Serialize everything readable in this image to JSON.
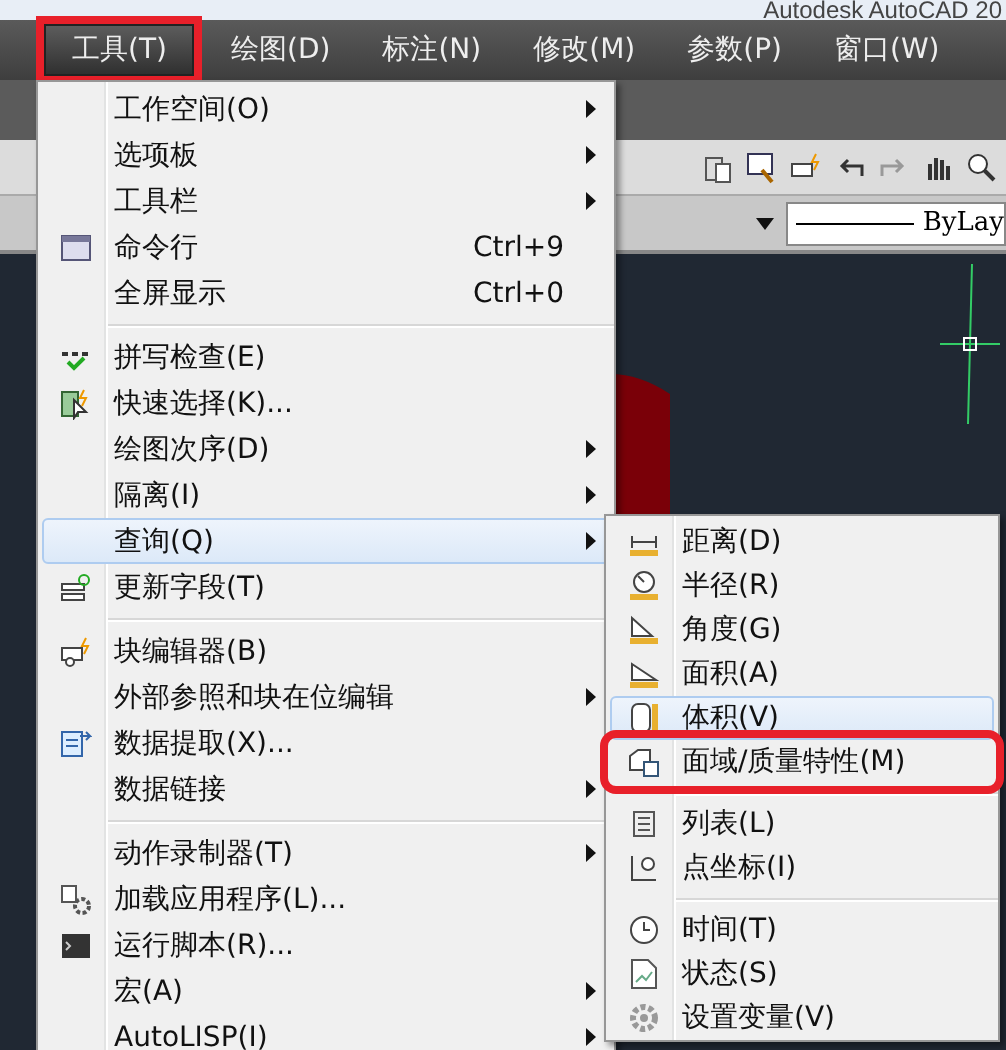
{
  "window": {
    "title": "Autodesk AutoCAD 20"
  },
  "menubar": [
    {
      "label": "工具(T)",
      "selected": true,
      "highlighted": true
    },
    {
      "label": "绘图(D)",
      "selected": false
    },
    {
      "label": "标注(N)",
      "selected": false
    },
    {
      "label": "修改(M)",
      "selected": false
    },
    {
      "label": "参数(P)",
      "selected": false
    },
    {
      "label": "窗口(W)",
      "selected": false
    }
  ],
  "properties": {
    "linetype": "ByLay"
  },
  "menu": [
    {
      "kind": "item",
      "label": "工作空间(O)",
      "submenu": true,
      "selected": false
    },
    {
      "kind": "item",
      "label": "选项板",
      "submenu": true,
      "selected": false
    },
    {
      "kind": "item",
      "label": "工具栏",
      "submenu": true,
      "selected": false
    },
    {
      "kind": "item",
      "label": "命令行",
      "shortcut": "Ctrl+9",
      "submenu": false,
      "selected": false
    },
    {
      "kind": "item",
      "label": "全屏显示",
      "shortcut": "Ctrl+0",
      "submenu": false,
      "selected": false
    },
    {
      "kind": "separator"
    },
    {
      "kind": "item",
      "label": "拼写检查(E)",
      "submenu": false,
      "selected": false
    },
    {
      "kind": "item",
      "label": "快速选择(K)...",
      "submenu": false,
      "selected": false
    },
    {
      "kind": "item",
      "label": "绘图次序(D)",
      "submenu": true,
      "selected": false
    },
    {
      "kind": "item",
      "label": "隔离(I)",
      "submenu": true,
      "selected": false
    },
    {
      "kind": "item",
      "label": "查询(Q)",
      "submenu": true,
      "selected": true
    },
    {
      "kind": "item",
      "label": "更新字段(T)",
      "submenu": false,
      "selected": false
    },
    {
      "kind": "separator"
    },
    {
      "kind": "item",
      "label": "块编辑器(B)",
      "submenu": false,
      "selected": false
    },
    {
      "kind": "item",
      "label": "外部参照和块在位编辑",
      "submenu": true,
      "selected": false
    },
    {
      "kind": "item",
      "label": "数据提取(X)...",
      "submenu": false,
      "selected": false
    },
    {
      "kind": "item",
      "label": "数据链接",
      "submenu": true,
      "selected": false
    },
    {
      "kind": "separator"
    },
    {
      "kind": "item",
      "label": "动作录制器(T)",
      "submenu": true,
      "selected": false
    },
    {
      "kind": "item",
      "label": "加载应用程序(L)...",
      "submenu": false,
      "selected": false
    },
    {
      "kind": "item",
      "label": "运行脚本(R)...",
      "submenu": false,
      "selected": false
    },
    {
      "kind": "item",
      "label": "宏(A)",
      "submenu": true,
      "selected": false
    },
    {
      "kind": "item",
      "label": "AutoLISP(I)",
      "submenu": true,
      "selected": false
    }
  ],
  "submenu": [
    {
      "kind": "item",
      "label": "距离(D)",
      "selected": false
    },
    {
      "kind": "item",
      "label": "半径(R)",
      "selected": false
    },
    {
      "kind": "item",
      "label": "角度(G)",
      "selected": false
    },
    {
      "kind": "item",
      "label": "面积(A)",
      "selected": false
    },
    {
      "kind": "item",
      "label": "体积(V)",
      "selected": true
    },
    {
      "kind": "item",
      "label": "面域/质量特性(M)",
      "selected": false,
      "highlighted": true
    },
    {
      "kind": "separator"
    },
    {
      "kind": "item",
      "label": "列表(L)",
      "selected": false
    },
    {
      "kind": "item",
      "label": "点坐标(I)",
      "selected": false
    },
    {
      "kind": "separator"
    },
    {
      "kind": "item",
      "label": "时间(T)",
      "selected": false
    },
    {
      "kind": "item",
      "label": "状态(S)",
      "selected": false
    },
    {
      "kind": "item",
      "label": "设置变量(V)",
      "selected": false
    }
  ]
}
